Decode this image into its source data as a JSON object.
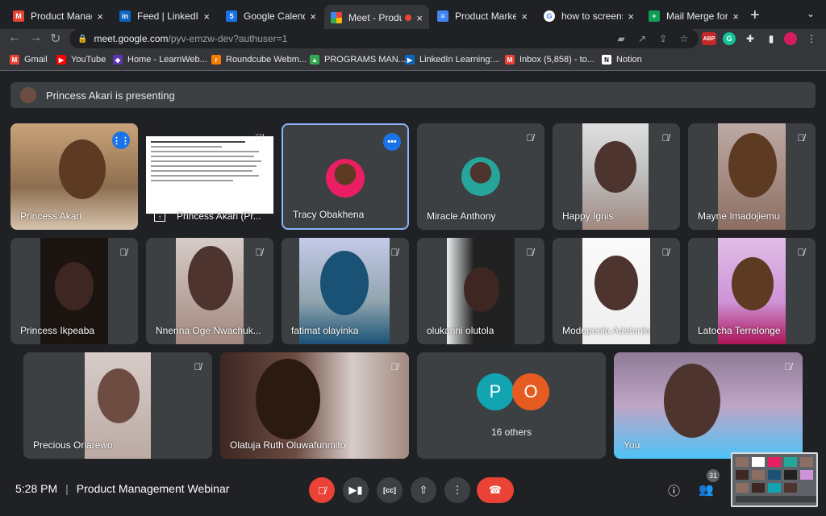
{
  "browser": {
    "tabs": [
      {
        "title": "Product Managem",
        "favicon": "gmail-icon",
        "color": "#ea4335",
        "letter": "M"
      },
      {
        "title": "Feed | LinkedIn",
        "favicon": "linkedin-icon",
        "color": "#0a66c2",
        "letter": "in"
      },
      {
        "title": "Google Calendar",
        "favicon": "calendar-icon",
        "color": "#1a73e8",
        "letter": "5"
      },
      {
        "title": "Meet - Produ",
        "favicon": "meet-icon",
        "color": "#00897b",
        "letter": "",
        "active": true
      },
      {
        "title": "Product Marketin",
        "favicon": "docs-icon",
        "color": "#4285f4",
        "letter": "≡"
      },
      {
        "title": "how to screensho",
        "favicon": "google-icon",
        "color": "#ffffff",
        "letter": "G"
      },
      {
        "title": "Mail Merge for NT",
        "favicon": "sheets-icon",
        "color": "#0f9d58",
        "letter": "+"
      }
    ],
    "new_tab": "+",
    "tab_close": "×",
    "url_host": "meet.google.com",
    "url_path": "/pyv-emzw-dev?authuser=1",
    "bookmarks": [
      {
        "label": "Gmail",
        "color": "#ea4335",
        "letter": "M"
      },
      {
        "label": "YouTube",
        "color": "#ff0000",
        "letter": "▶"
      },
      {
        "label": "Home - LearnWeb...",
        "color": "#5e35b1",
        "letter": "◆"
      },
      {
        "label": "Roundcube Webm...",
        "color": "#f57c00",
        "letter": "r"
      },
      {
        "label": "PROGRAMS MAN...",
        "color": "#34a853",
        "letter": "▲"
      },
      {
        "label": "LinkedIn Learning:...",
        "color": "#0a66c2",
        "letter": "▶"
      },
      {
        "label": "Inbox (5,858) - to...",
        "color": "#ea4335",
        "letter": "M"
      },
      {
        "label": "Notion",
        "color": "#000000",
        "letter": "N"
      }
    ],
    "extension_abp": "ABP",
    "extension_g": "G"
  },
  "meet": {
    "presenting_text": "Princess Akari is presenting",
    "tiles": [
      {
        "name": "Princess Akari",
        "state": "speaking"
      },
      {
        "name": "Princess Akari (Pr...",
        "state": "presentation"
      },
      {
        "name": "Tracy Obakhena",
        "state": "selected"
      },
      {
        "name": "Miracle Anthony",
        "state": "muted"
      },
      {
        "name": "Happy Ignis",
        "state": "muted"
      },
      {
        "name": "Mayne Imadojiemu",
        "state": "muted"
      },
      {
        "name": "Princess Ikpeaba",
        "state": "muted"
      },
      {
        "name": "Nnenna Oge Nwachuk...",
        "state": "muted"
      },
      {
        "name": "fatimat olayinka",
        "state": "muted"
      },
      {
        "name": "olukanni olutola",
        "state": "muted"
      },
      {
        "name": "Modupeola Adetunla",
        "state": "muted"
      },
      {
        "name": "Latocha Terrelonge",
        "state": "muted"
      },
      {
        "name": "Precious Oriarewo",
        "state": "muted"
      },
      {
        "name": "Olatuja Ruth Oluwafunmito",
        "state": "muted"
      },
      {
        "name": "16 others",
        "state": "others"
      },
      {
        "name": "You",
        "state": "muted"
      }
    ],
    "others_initials": [
      "P",
      "O"
    ],
    "others_colors": [
      "#12a4b0",
      "#e65c20"
    ],
    "time": "5:28 PM",
    "separator": "|",
    "meeting_title": "Product Management Webinar",
    "participant_count": "31"
  }
}
